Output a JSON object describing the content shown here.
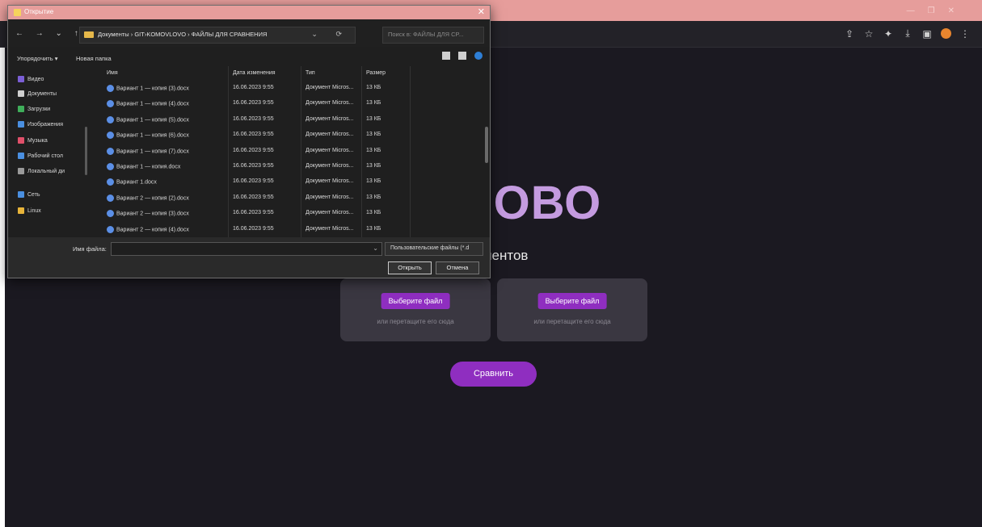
{
  "browser": {
    "window_controls": [
      "—",
      "❐",
      "✕"
    ],
    "toolbar_icons": [
      "share-icon",
      "star-icon",
      "puzzle-icon",
      "download-icon",
      "sidebar-icon",
      "profile-avatar",
      "more-icon"
    ],
    "toolbar_glyphs": [
      "⇪",
      "☆",
      "✦",
      "⤓",
      "▣",
      "",
      "⋮"
    ]
  },
  "page": {
    "title_visible": "S СЛОВО",
    "subtitle_visible": "документов",
    "drop_zones": [
      {
        "button": "Выберите файл",
        "hint": "или перетащите его сюда"
      },
      {
        "button": "Выберите файл",
        "hint": "или перетащите его сюда"
      }
    ],
    "compare_button": "Сравнить",
    "accent_color": "#8f2ec0",
    "title_color": "#c49be0"
  },
  "dialog": {
    "title": "Открытие",
    "close": "✕",
    "nav_arrows": "← → ⌄ ↑",
    "address": "Документы › GIT›KOMOVLOVO › ФАЙЛЫ ДЛЯ СРАВНЕНИЯ",
    "address_controls": "⌄ ⟳",
    "search_placeholder": "Поиск в: ФАЙЛЫ ДЛЯ СР...",
    "toolbar": {
      "organize": "Упорядочить ▾",
      "new_folder": "Новая папка"
    },
    "sidebar": [
      {
        "label": "Видео",
        "color": "#7b5fd6"
      },
      {
        "label": "Документы",
        "color": "#cfcfcf"
      },
      {
        "label": "Загрузки",
        "color": "#3fae5a"
      },
      {
        "label": "Изображения",
        "color": "#4a8fe0"
      },
      {
        "label": "Музыка",
        "color": "#e0506a"
      },
      {
        "label": "Рабочий стол",
        "color": "#4a8fe0"
      },
      {
        "label": "Локальный ди",
        "color": "#9a9a9a"
      },
      {
        "label": "Сеть",
        "color": "#4a8fe0"
      },
      {
        "label": "Linux",
        "color": "#e8b43a"
      }
    ],
    "columns": [
      "Имя",
      "Дата изменения",
      "Тип",
      "Размер"
    ],
    "files": [
      {
        "name": "Вариант 1 — копия (3).docx",
        "date": "16.06.2023 9:55",
        "type": "Документ Micros...",
        "size": "13 КБ"
      },
      {
        "name": "Вариант 1 — копия (4).docx",
        "date": "16.06.2023 9:55",
        "type": "Документ Micros...",
        "size": "13 КБ"
      },
      {
        "name": "Вариант 1 — копия (5).docx",
        "date": "16.06.2023 9:55",
        "type": "Документ Micros...",
        "size": "13 КБ"
      },
      {
        "name": "Вариант 1 — копия (6).docx",
        "date": "16.06.2023 9:55",
        "type": "Документ Micros...",
        "size": "13 КБ"
      },
      {
        "name": "Вариант 1 — копия (7).docx",
        "date": "16.06.2023 9:55",
        "type": "Документ Micros...",
        "size": "13 КБ"
      },
      {
        "name": "Вариант 1 — копия.docx",
        "date": "16.06.2023 9:55",
        "type": "Документ Micros...",
        "size": "13 КБ"
      },
      {
        "name": "Вариант 1.docx",
        "date": "16.06.2023 9:55",
        "type": "Документ Micros...",
        "size": "13 КБ"
      },
      {
        "name": "Вариант 2 — копия (2).docx",
        "date": "16.06.2023 9:55",
        "type": "Документ Micros...",
        "size": "13 КБ"
      },
      {
        "name": "Вариант 2 — копия (3).docx",
        "date": "16.06.2023 9:55",
        "type": "Документ Micros...",
        "size": "13 КБ"
      },
      {
        "name": "Вариант 2 — копия (4).docx",
        "date": "16.06.2023 9:55",
        "type": "Документ Micros...",
        "size": "13 КБ"
      }
    ],
    "footer": {
      "filename_label": "Имя файла:",
      "filename_value": "",
      "filter": "Пользовательские файлы (*.d",
      "open": "Открыть",
      "cancel": "Отмена"
    }
  }
}
